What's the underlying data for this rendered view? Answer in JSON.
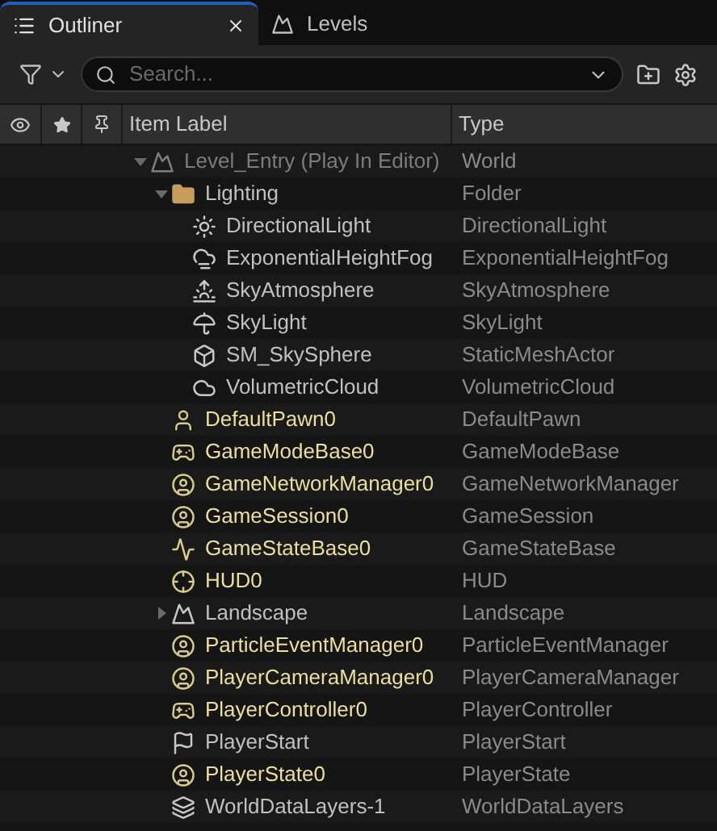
{
  "tabs": [
    {
      "label": "Outliner",
      "selected": true,
      "kind": "outliner"
    },
    {
      "label": "Levels",
      "selected": false,
      "kind": "levels"
    }
  ],
  "search": {
    "placeholder": "Search..."
  },
  "columns": {
    "label": "Item Label",
    "type": "Type"
  },
  "tree": [
    {
      "label": "Level_Entry (Play In Editor)",
      "type": "World",
      "kind": "world",
      "dimmed": true,
      "spawned": false,
      "expanded": true,
      "children": [
        {
          "label": "Lighting",
          "type": "Folder",
          "kind": "folder",
          "dimmed": false,
          "spawned": false,
          "expanded": true,
          "children": [
            {
              "label": "DirectionalLight",
              "type": "DirectionalLight",
              "kind": "light",
              "dimmed": false,
              "spawned": false
            },
            {
              "label": "ExponentialHeightFog",
              "type": "ExponentialHeightFog",
              "kind": "fog",
              "dimmed": false,
              "spawned": false
            },
            {
              "label": "SkyAtmosphere",
              "type": "SkyAtmosphere",
              "kind": "atmosphere",
              "dimmed": false,
              "spawned": false
            },
            {
              "label": "SkyLight",
              "type": "SkyLight",
              "kind": "skylight",
              "dimmed": false,
              "spawned": false
            },
            {
              "label": "SM_SkySphere",
              "type": "StaticMeshActor",
              "kind": "mesh",
              "dimmed": false,
              "spawned": false
            },
            {
              "label": "VolumetricCloud",
              "type": "VolumetricCloud",
              "kind": "cloud",
              "dimmed": false,
              "spawned": false
            }
          ]
        },
        {
          "label": "DefaultPawn0",
          "type": "DefaultPawn",
          "kind": "pawn",
          "dimmed": false,
          "spawned": true
        },
        {
          "label": "GameModeBase0",
          "type": "GameModeBase",
          "kind": "gamemode",
          "dimmed": false,
          "spawned": true
        },
        {
          "label": "GameNetworkManager0",
          "type": "GameNetworkManager",
          "kind": "info",
          "dimmed": false,
          "spawned": true
        },
        {
          "label": "GameSession0",
          "type": "GameSession",
          "kind": "info",
          "dimmed": false,
          "spawned": true
        },
        {
          "label": "GameStateBase0",
          "type": "GameStateBase",
          "kind": "graph",
          "dimmed": false,
          "spawned": true
        },
        {
          "label": "HUD0",
          "type": "HUD",
          "kind": "hud",
          "dimmed": false,
          "spawned": true
        },
        {
          "label": "Landscape",
          "type": "Landscape",
          "kind": "landscape",
          "dimmed": false,
          "spawned": false,
          "expanded": false
        },
        {
          "label": "ParticleEventManager0",
          "type": "ParticleEventManager",
          "kind": "info",
          "dimmed": false,
          "spawned": true
        },
        {
          "label": "PlayerCameraManager0",
          "type": "PlayerCameraManager",
          "kind": "info",
          "dimmed": false,
          "spawned": true
        },
        {
          "label": "PlayerController0",
          "type": "PlayerController",
          "kind": "controller",
          "dimmed": false,
          "spawned": true
        },
        {
          "label": "PlayerStart",
          "type": "PlayerStart",
          "kind": "start",
          "dimmed": false,
          "spawned": false
        },
        {
          "label": "PlayerState0",
          "type": "PlayerState",
          "kind": "info",
          "dimmed": false,
          "spawned": true
        },
        {
          "label": "WorldDataLayers-1",
          "type": "WorldDataLayers",
          "kind": "layers",
          "dimmed": false,
          "spawned": false
        }
      ]
    }
  ]
}
